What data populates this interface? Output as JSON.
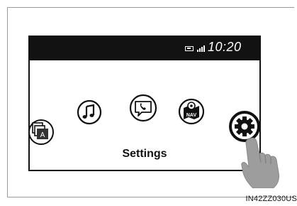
{
  "status_bar": {
    "time": "10:20"
  },
  "screen": {
    "selected_label": "Settings"
  },
  "apps": [
    {
      "icon": "apps-icon"
    },
    {
      "icon": "music-icon"
    },
    {
      "icon": "phone-message-icon"
    },
    {
      "icon": "nav-icon",
      "label": "NAV"
    },
    {
      "icon": "gear-icon"
    }
  ],
  "caption": "IN42ZZ030US"
}
